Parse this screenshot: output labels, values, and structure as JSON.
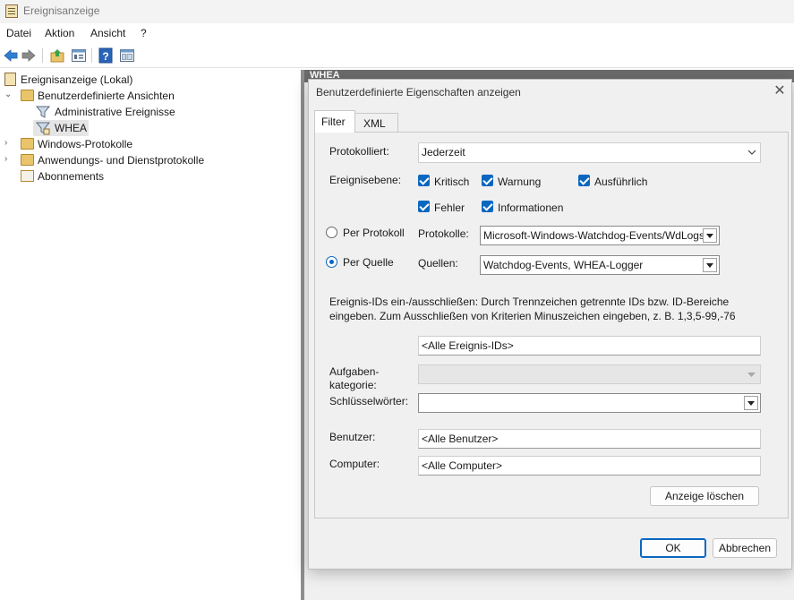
{
  "app": {
    "title": "Ereignisanzeige"
  },
  "menu": [
    "Datei",
    "Aktion",
    "Ansicht",
    "?"
  ],
  "tree": {
    "root": "Ereignisanzeige (Lokal)",
    "custom_views": "Benutzerdefinierte Ansichten",
    "admin_events": "Administrative Ereignisse",
    "whea": "WHEA",
    "windows_logs": "Windows-Protokolle",
    "app_logs": "Anwendungs- und Dienstprotokolle",
    "subscriptions": "Abonnements"
  },
  "background_header": "WHEA",
  "dialog": {
    "title": "Benutzerdefinierte Eigenschaften anzeigen",
    "tabs": {
      "filter": "Filter",
      "xml": "XML"
    },
    "logged_label": "Protokolliert:",
    "logged_value": "Jederzeit",
    "level_label": "Ereignisebene:",
    "levels": {
      "critical": "Kritisch",
      "warning": "Warnung",
      "verbose": "Ausführlich",
      "error": "Fehler",
      "information": "Informationen"
    },
    "level_checked": {
      "critical": true,
      "warning": true,
      "verbose": true,
      "error": true,
      "information": true
    },
    "by_log": {
      "label": "Per Protokoll",
      "field_label": "Protokolle:",
      "value": "Microsoft-Windows-Watchdog-Events/WdLogs"
    },
    "by_source": {
      "label": "Per Quelle",
      "field_label": "Quellen:",
      "value": "Watchdog-Events, WHEA-Logger"
    },
    "selected_mode": "Per Quelle",
    "ids_desc_line1": "Ereignis-IDs ein-/ausschließen: Durch Trennzeichen getrennte IDs bzw. ID-Bereiche",
    "ids_desc_line2": "eingeben. Zum Ausschließen von Kriterien Minuszeichen eingeben, z. B. 1,3,5-99,-76",
    "ids_value": "<Alle Ereignis-IDs>",
    "task_label_1": "Aufgaben-",
    "task_label_2": "kategorie:",
    "task_value": "",
    "keywords_label": "Schlüsselwörter:",
    "keywords_value": "",
    "user_label": "Benutzer:",
    "user_value": "<Alle Benutzer>",
    "computer_label": "Computer:",
    "computer_value": "<Alle Computer>",
    "clear_button": "Anzeige löschen",
    "ok_button": "OK",
    "cancel_button": "Abbrechen"
  },
  "colors": {
    "accent": "#0a67c0",
    "dialog_bg": "#f0f0f0"
  }
}
